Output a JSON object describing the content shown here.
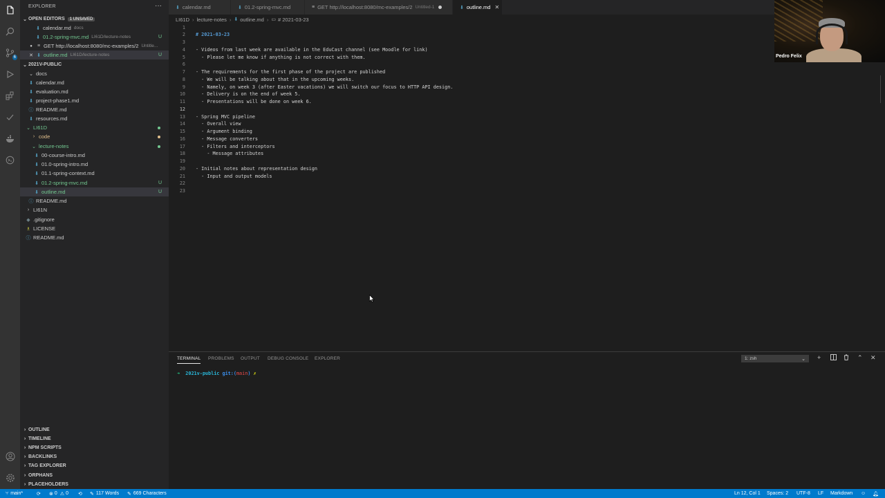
{
  "activity": {
    "icons": [
      "files-icon",
      "search-icon",
      "source-control-icon",
      "run-debug-icon",
      "extensions-icon",
      "testing-icon",
      "docker-icon",
      "remote-icon",
      "account-icon",
      "settings-gear-icon"
    ],
    "scm_badge": "6"
  },
  "explorer": {
    "title": "EXPLORER",
    "open_editors": {
      "label": "OPEN EDITORS",
      "badge": "1 UNSAVED",
      "items": [
        {
          "name": "calendar.md",
          "desc": "docs",
          "status": ""
        },
        {
          "name": "01.2-spring-mvc.md",
          "desc": "LI61D/lecture-notes",
          "status": "U"
        },
        {
          "name": "GET http://localhost:8080/mc-examples/2",
          "desc": "Untitle...",
          "status": ""
        },
        {
          "name": "outline.md",
          "desc": "LI61D/lecture-notes",
          "status": "U"
        }
      ]
    },
    "folder": {
      "label": "2021V-PUBLIC",
      "items": [
        {
          "name": "docs"
        },
        {
          "name": "calendar.md"
        },
        {
          "name": "evaluation.md"
        },
        {
          "name": "project-phase1.md"
        },
        {
          "name": "README.md"
        },
        {
          "name": "resources.md"
        },
        {
          "name": "LI61D"
        },
        {
          "name": "code"
        },
        {
          "name": "lecture-notes"
        },
        {
          "name": "00-course-intro.md"
        },
        {
          "name": "01.0-spring-intro.md"
        },
        {
          "name": "01.1-spring-context.md"
        },
        {
          "name": "01.2-spring-mvc.md",
          "status": "U"
        },
        {
          "name": "outline.md",
          "status": "U"
        },
        {
          "name": "README.md"
        },
        {
          "name": "LI61N"
        },
        {
          "name": ".gitignore"
        },
        {
          "name": "LICENSE"
        },
        {
          "name": "README.md"
        }
      ]
    },
    "bottom_sections": [
      "OUTLINE",
      "TIMELINE",
      "NPM SCRIPTS",
      "BACKLINKS",
      "TAG EXPLORER",
      "ORPHANS",
      "PLACEHOLDERS"
    ]
  },
  "tabs": [
    {
      "label": "calendar.md",
      "sub": "",
      "active": false
    },
    {
      "label": "01.2-spring-mvc.md",
      "sub": "",
      "active": false
    },
    {
      "label": "GET http://localhost:8080/mc-examples/2",
      "sub": "Untitled-1",
      "active": false
    },
    {
      "label": "outline.md",
      "sub": "",
      "active": true
    }
  ],
  "breadcrumb": [
    "LI61D",
    "lecture-notes",
    "outline.md",
    "# 2021-03-23"
  ],
  "editor": {
    "current_line": 12,
    "lines": [
      "",
      "# 2021-03-23",
      "",
      "- Videos from last week are available in the EduCast channel (see Moodle for link)",
      "  - Please let me know if anything is not correct with them.",
      "",
      "- The requirements for the first phase of the project are published",
      "  - We will be talking about that in the upcoming weeks.",
      "  - Namely, on week 3 (after Easter vacations) we will switch our focus to HTTP API design.",
      "  - Delivery is on the end of week 5.",
      "  - Presentations will be done on week 6.",
      "",
      "- Spring MVC pipeline",
      "  - Overall view",
      "  - Argument binding",
      "  - Message converters",
      "  - Filters and interceptors",
      "    - Message attributes",
      "",
      "- Initial notes about representation design",
      "  - Input and output models",
      "",
      ""
    ]
  },
  "panel": {
    "tabs": [
      "TERMINAL",
      "PROBLEMS",
      "OUTPUT",
      "DEBUG CONSOLE",
      "EXPLORER"
    ],
    "active_tab": "TERMINAL",
    "terminal_select": "1: zsh",
    "prompt": {
      "arrow": "➜",
      "dir": "2021v-public",
      "git": "git:(",
      "branch": "main",
      "git_close": ")",
      "dirty": "✗"
    }
  },
  "statusbar": {
    "branch": "main*",
    "sync": "⟳",
    "errors": "0",
    "warnings": "0",
    "words": "117 Words",
    "chars": "669 Characters",
    "position": "Ln 12, Col 1",
    "spaces": "Spaces: 2",
    "encoding": "UTF-8",
    "eol": "LF",
    "language": "Markdown"
  },
  "webcam": {
    "name": "Pedro Felix"
  },
  "colors": {
    "accent": "#007acc",
    "untracked": "#73c991",
    "modified": "#e2c08d"
  }
}
